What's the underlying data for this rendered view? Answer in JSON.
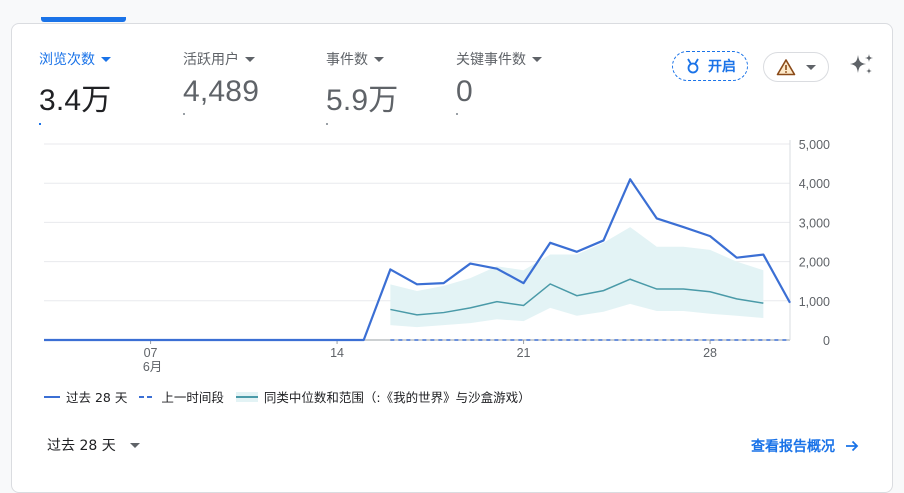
{
  "metrics": [
    {
      "label": "浏览次数",
      "value": "3.4万"
    },
    {
      "label": "活跃用户",
      "value": "4,489"
    },
    {
      "label": "事件数",
      "value": "5.9万"
    },
    {
      "label": "关键事件数",
      "value": "0"
    }
  ],
  "toggle": {
    "label": "开启"
  },
  "chart_data": {
    "type": "line",
    "y_ticks": [
      "5,000",
      "4,000",
      "3,000",
      "2,000",
      "1,000",
      "0"
    ],
    "ylim": [
      0,
      5000
    ],
    "x_tick_labels": [
      {
        "label": "07",
        "sub": "6月",
        "day": 7
      },
      {
        "label": "14",
        "sub": "",
        "day": 14
      },
      {
        "label": "21",
        "sub": "",
        "day": 21
      },
      {
        "label": "28",
        "sub": "",
        "day": 28
      }
    ],
    "x": [
      3,
      4,
      5,
      6,
      7,
      8,
      9,
      10,
      11,
      12,
      13,
      14,
      15,
      16,
      17,
      18,
      19,
      20,
      21,
      22,
      23,
      24,
      25,
      26,
      27,
      28,
      29,
      30,
      31
    ],
    "series": [
      {
        "name": "过去 28 天",
        "values": [
          0,
          0,
          0,
          0,
          0,
          0,
          0,
          0,
          0,
          0,
          0,
          0,
          0,
          1800,
          1420,
          1450,
          1950,
          1820,
          1450,
          2480,
          2250,
          2540,
          4100,
          3100,
          2880,
          2650,
          2100,
          2180,
          950
        ]
      },
      {
        "name": "上一时间段",
        "values": [
          0,
          0,
          0,
          0,
          0,
          0,
          0,
          0,
          0,
          0,
          0,
          0,
          0,
          0,
          0,
          0,
          0,
          0,
          0,
          0,
          0,
          0,
          0,
          0,
          0,
          0,
          0,
          0,
          0
        ]
      }
    ],
    "peer_median": {
      "x": [
        16,
        17,
        18,
        19,
        20,
        21,
        22,
        23,
        24,
        25,
        26,
        27,
        28,
        29,
        30
      ],
      "values": [
        780,
        640,
        700,
        820,
        980,
        880,
        1430,
        1130,
        1260,
        1550,
        1300,
        1300,
        1230,
        1050,
        940
      ]
    },
    "peer_range_low": [
      380,
      330,
      380,
      430,
      530,
      480,
      820,
      620,
      720,
      920,
      740,
      740,
      670,
      620,
      560
    ],
    "peer_range_high": [
      1420,
      1250,
      1380,
      1580,
      1880,
      1780,
      2180,
      2180,
      2480,
      2880,
      2380,
      2380,
      2300,
      2000,
      1780
    ],
    "legend": [
      "过去 28 天",
      "上一时间段",
      "同类中位数和范围（:《我的世界》与沙盒游戏）"
    ]
  },
  "footer": {
    "range": "过去 28 天",
    "link": "查看报告概况"
  },
  "colors": {
    "accent": "#1a73e8",
    "main_line": "#3b6fd4",
    "peer_line": "#4a9aa8",
    "peer_band": "#e3f3f5"
  }
}
